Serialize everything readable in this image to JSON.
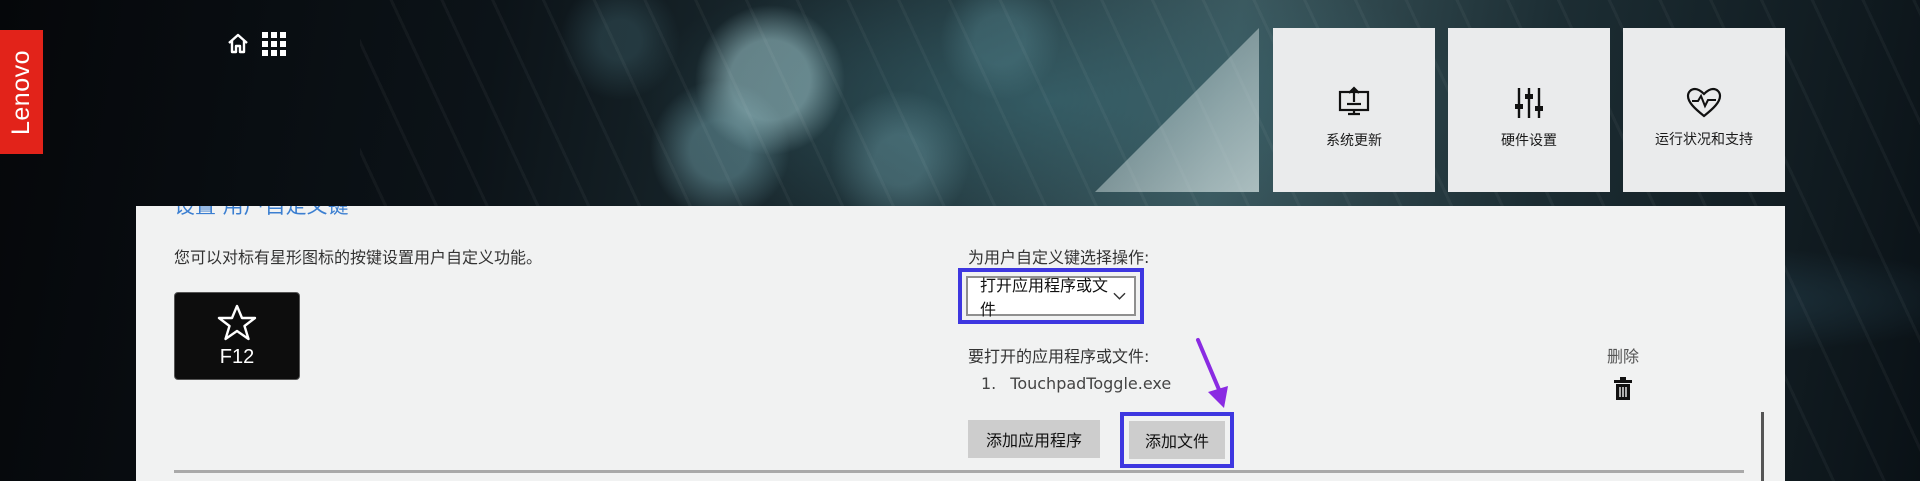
{
  "brand": {
    "logo_text": "Lenovo",
    "logo_color": "#e2231a"
  },
  "header": {
    "icons": [
      "home-icon",
      "apps-grid-icon"
    ],
    "tiles": [
      {
        "label": "系统更新",
        "icon": "system-update-icon"
      },
      {
        "label": "硬件设置",
        "icon": "sliders-icon"
      },
      {
        "label": "运行状况和支持",
        "icon": "heart-pulse-icon"
      }
    ]
  },
  "panel": {
    "heading": "设置 用户自定义键",
    "description": "您可以对标有星形图标的按键设置用户自定义功能。",
    "key": {
      "label": "F12",
      "icon": "star-icon"
    },
    "action_select": {
      "title": "为用户自定义键选择操作:",
      "value": "打开应用程序或文件"
    },
    "files": {
      "title": "要打开的应用程序或文件:",
      "items": [
        {
          "index": "1.",
          "name": "TouchpadToggle.exe"
        }
      ]
    },
    "delete_label": "删除",
    "buttons": {
      "add_app": "添加应用程序",
      "add_file": "添加文件"
    },
    "highlight_color": "#3e37e0",
    "arrow_color": "#8a2be2"
  }
}
